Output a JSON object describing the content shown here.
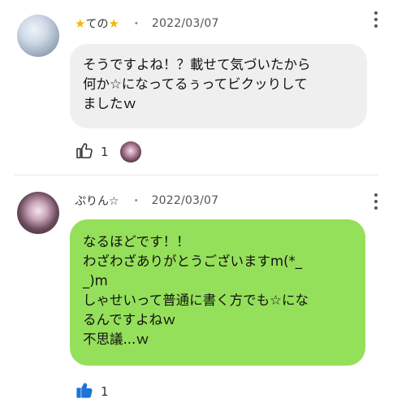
{
  "comments": [
    {
      "author": "ての",
      "author_icon_left": "star-icon",
      "author_icon_right": "star-icon",
      "date": "2022/03/07",
      "separator": "・",
      "text": "そうですよね！？載せて気づいたから\n何か☆になってるぅってビクッりして\nましたｗ",
      "likes": {
        "count": "1",
        "liked": false
      }
    },
    {
      "author": "ぷりん☆",
      "date": "2022/03/07",
      "separator": "・",
      "text": "なるほどです！！\nわざわざありがとうございますm(*_\n_)m\nしゃせいって普通に書く方でも☆にな\nるんですよねｗ\n不思議...ｗ",
      "likes": {
        "count": "1",
        "liked": true
      }
    }
  ],
  "colors": {
    "bubble_other": "#efefef",
    "bubble_self": "#95e05a",
    "like_active": "#1e74d6",
    "like_inactive": "#333333"
  }
}
